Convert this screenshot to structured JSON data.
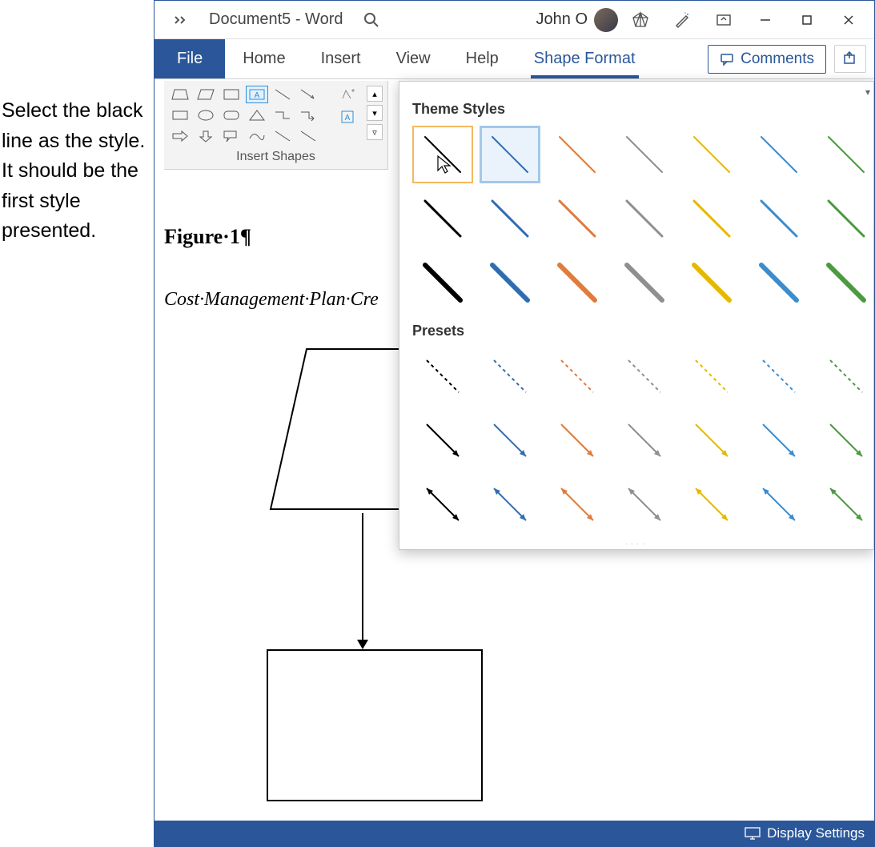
{
  "instruction": {
    "line1": "Select the black line as the style.",
    "line2": "It should be the first style presented."
  },
  "titlebar": {
    "doc_title": "Document5  -  Word",
    "user_name": "John O"
  },
  "tabs": {
    "file": "File",
    "home": "Home",
    "insert": "Insert",
    "view": "View",
    "help": "Help",
    "shape_format": "Shape Format"
  },
  "ribbon_right": {
    "comments": "Comments"
  },
  "shapes_group_label": "Insert Shapes",
  "document": {
    "heading": "Figure·1¶",
    "subheading": "Cost·Management·Plan·Cre"
  },
  "gallery": {
    "theme_styles_label": "Theme Styles",
    "presets_label": "Presets",
    "theme_colors": [
      "#000000",
      "#2f6db3",
      "#e07b3c",
      "#8f8f8f",
      "#e6b800",
      "#3a8dd0",
      "#4a9b3e"
    ],
    "theme_weights": [
      2,
      3,
      6
    ],
    "preset_types": [
      "dashed",
      "arrow",
      "double-arrow"
    ]
  },
  "statusbar": {
    "display_settings": "Display Settings"
  }
}
